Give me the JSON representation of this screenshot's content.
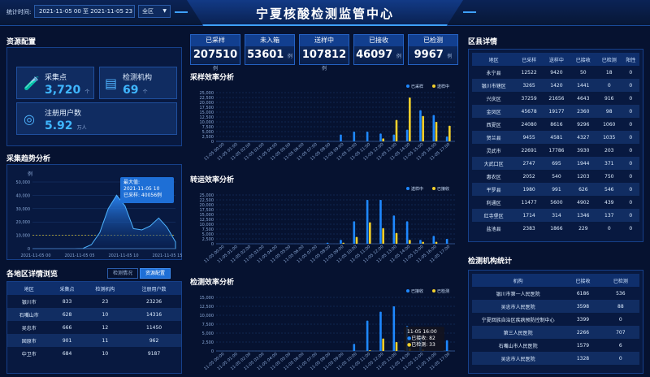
{
  "header": {
    "title": "宁夏核酸检测监管中心",
    "filter_label": "统计时间:",
    "date_range": "2021-11-05 00 至 2021-11-05 23",
    "area_select": "全区"
  },
  "resource": {
    "title": "资源配置",
    "sampling_points": {
      "label": "采集点",
      "value": "3,720",
      "unit": "个"
    },
    "labs": {
      "label": "检测机构",
      "value": "69",
      "unit": "个"
    },
    "registered_users": {
      "label": "注册用户数",
      "value": "5.92",
      "unit": "万人"
    }
  },
  "stats": [
    {
      "label": "已采样",
      "value": "207510",
      "unit": "例"
    },
    {
      "label": "未入箱",
      "value": "53601",
      "unit": "例"
    },
    {
      "label": "送样中",
      "value": "107812",
      "unit": "例"
    },
    {
      "label": "已接收",
      "value": "46097",
      "unit": "例"
    },
    {
      "label": "已检测",
      "value": "9967",
      "unit": "例"
    }
  ],
  "trend": {
    "title": "采集趋势分析",
    "unit_label": "例",
    "tooltip_title": "最大值:",
    "tooltip_time": "2021-11-05 10",
    "tooltip_value": "已采样: 40056例"
  },
  "region_browse": {
    "title": "各地区详情浏览",
    "tab_detail": "检测情况",
    "tab_resource": "资源配置",
    "headers": [
      "地区",
      "采集点",
      "检测机构",
      "注册用户数"
    ],
    "rows": [
      [
        "银川市",
        "833",
        "23",
        "23236"
      ],
      [
        "石嘴山市",
        "628",
        "10",
        "14316"
      ],
      [
        "吴忠市",
        "666",
        "12",
        "11450"
      ],
      [
        "固原市",
        "901",
        "11",
        "962"
      ],
      [
        "中卫市",
        "684",
        "10",
        "9187"
      ]
    ]
  },
  "district": {
    "title": "区县详情",
    "headers": [
      "地区",
      "已采样",
      "送样中",
      "已接收",
      "已检测",
      "阳性"
    ],
    "rows": [
      [
        "永宁县",
        "12522",
        "9420",
        "50",
        "18",
        "0"
      ],
      [
        "银川市辖区",
        "3265",
        "1420",
        "1441",
        "0",
        "0"
      ],
      [
        "兴庆区",
        "37259",
        "21656",
        "4643",
        "916",
        "0"
      ],
      [
        "金凤区",
        "45678",
        "19177",
        "2360",
        "98",
        "0"
      ],
      [
        "西夏区",
        "24080",
        "8616",
        "9296",
        "1060",
        "0"
      ],
      [
        "贺兰县",
        "9455",
        "4581",
        "4327",
        "1035",
        "0"
      ],
      [
        "灵武市",
        "22691",
        "17786",
        "3930",
        "203",
        "0"
      ],
      [
        "大武口区",
        "2747",
        "695",
        "1944",
        "371",
        "0"
      ],
      [
        "惠农区",
        "2052",
        "540",
        "1203",
        "750",
        "0"
      ],
      [
        "平罗县",
        "1980",
        "991",
        "626",
        "546",
        "0"
      ],
      [
        "利通区",
        "11477",
        "5600",
        "4902",
        "439",
        "0"
      ],
      [
        "红寺堡区",
        "1714",
        "314",
        "1346",
        "137",
        "0"
      ],
      [
        "盐池县",
        "2383",
        "1866",
        "229",
        "0",
        "0"
      ]
    ]
  },
  "institutions": {
    "title": "检测机构统计",
    "headers": [
      "机构",
      "已接收",
      "已检测"
    ],
    "rows": [
      [
        "银川市第一人民医院",
        "6186",
        "536"
      ],
      [
        "吴忠市人民医院",
        "3598",
        "88"
      ],
      [
        "宁夏回族自治区疾病预防控制中心",
        "3399",
        "0"
      ],
      [
        "第三人民医院",
        "2266",
        "707"
      ],
      [
        "石嘴山市人民医院",
        "1579",
        "6"
      ],
      [
        "吴忠市人民医院",
        "1328",
        "0"
      ]
    ]
  },
  "colors": {
    "blue": "#1e88ff",
    "yellow": "#f3d12b",
    "accent": "#3fb6ff"
  },
  "chart_data": [
    {
      "type": "area",
      "id": "trend",
      "x": [
        "2021-11-05 00",
        "2021-11-05 05",
        "2021-11-05 10",
        "2021-11-05 15"
      ],
      "tick_labels": [
        "2021-11-05 00",
        "2021-11-05 05",
        "2021-11-05 10",
        "2021-11-05 15"
      ],
      "series": [
        {
          "name": "已采样",
          "values": [
            0,
            0,
            0,
            0,
            0,
            0,
            200,
            3000,
            12000,
            30000,
            40056,
            32000,
            15000,
            14000,
            17000,
            23000,
            16000,
            5000
          ]
        }
      ],
      "ylim": [
        0,
        50000
      ],
      "yticks": [
        "0",
        "10,000",
        "20,000",
        "30,000",
        "40,000",
        "50,000"
      ],
      "reference_line": 10000
    },
    {
      "type": "bar",
      "id": "sampling",
      "title": "采样效率分析",
      "categories": [
        "11-05 00:00",
        "11-05 01:00",
        "11-05 02:00",
        "11-05 03:00",
        "11-05 04:00",
        "11-05 05:00",
        "11-05 06:00",
        "11-05 07:00",
        "11-05 08:00",
        "11-05 09:00",
        "11-05 10:00",
        "11-05 11:00",
        "11-05 12:00",
        "11-05 13:00",
        "11-05 14:00",
        "11-05 15:00",
        "11-05 16:00",
        "11-05 17:00"
      ],
      "series": [
        {
          "name": "已采样",
          "values": [
            0,
            0,
            0,
            0,
            0,
            0,
            0,
            0,
            200,
            3500,
            5000,
            5000,
            4000,
            3500,
            6000,
            16000,
            13500,
            2500
          ]
        },
        {
          "name": "送样中",
          "values": [
            0,
            0,
            0,
            0,
            0,
            0,
            0,
            0,
            0,
            0,
            0,
            0,
            1500,
            11000,
            22500,
            13000,
            10000,
            8000
          ]
        }
      ],
      "ylim": [
        0,
        25000
      ],
      "yticks": [
        "0",
        "2,500",
        "5,000",
        "7,500",
        "10,000",
        "12,500",
        "15,000",
        "17,500",
        "20,000",
        "22,500",
        "25,000"
      ]
    },
    {
      "type": "bar",
      "id": "transport",
      "title": "转运效率分析",
      "categories": [
        "11-05 00:00",
        "11-05 01:00",
        "11-05 02:00",
        "11-05 03:00",
        "11-05 04:00",
        "11-05 05:00",
        "11-05 06:00",
        "11-05 07:00",
        "11-05 08:00",
        "11-05 09:00",
        "11-05 10:00",
        "11-05 11:00",
        "11-05 12:00",
        "11-05 13:00",
        "11-05 14:00",
        "11-05 15:00",
        "11-05 16:00",
        "11-05 17:00"
      ],
      "series": [
        {
          "name": "送样中",
          "values": [
            0,
            0,
            0,
            0,
            0,
            0,
            0,
            0,
            500,
            2000,
            11500,
            22500,
            22500,
            14500,
            11500,
            2000,
            4000,
            2500
          ]
        },
        {
          "name": "已接收",
          "values": [
            0,
            0,
            0,
            0,
            0,
            0,
            0,
            0,
            0,
            500,
            3500,
            11000,
            8000,
            5500,
            2000,
            1000,
            1000,
            0
          ]
        }
      ],
      "ylim": [
        0,
        25000
      ],
      "yticks": [
        "0",
        "2,500",
        "5,000",
        "7,500",
        "10,000",
        "12,500",
        "15,000",
        "17,500",
        "20,000",
        "22,500",
        "25,000"
      ]
    },
    {
      "type": "bar",
      "id": "testing",
      "title": "检测效率分析",
      "categories": [
        "11-05 00:00",
        "11-05 01:00",
        "11-05 02:00",
        "11-05 03:00",
        "11-05 04:00",
        "11-05 05:00",
        "11-05 06:00",
        "11-05 07:00",
        "11-05 08:00",
        "11-05 09:00",
        "11-05 10:00",
        "11-05 11:00",
        "11-05 12:00",
        "11-05 13:00",
        "11-05 14:00",
        "11-05 15:00",
        "11-05 16:00",
        "11-05 17:00"
      ],
      "series": [
        {
          "name": "已接收",
          "values": [
            0,
            0,
            0,
            0,
            0,
            0,
            0,
            0,
            0,
            0,
            2000,
            8500,
            11000,
            12500,
            7000,
            4000,
            0,
            3000
          ]
        },
        {
          "name": "已检测",
          "values": [
            0,
            0,
            0,
            0,
            0,
            0,
            0,
            0,
            0,
            0,
            0,
            200,
            3500,
            2500,
            800,
            400,
            0,
            33
          ]
        }
      ],
      "ylim": [
        0,
        15000
      ],
      "yticks": [
        "0",
        "2,500",
        "5,000",
        "7,500",
        "10,000",
        "12,500",
        "15,000"
      ],
      "tooltip": {
        "time": "11-05 16:00",
        "lines": [
          "已接收: 82",
          "已检测: 33"
        ]
      }
    }
  ]
}
